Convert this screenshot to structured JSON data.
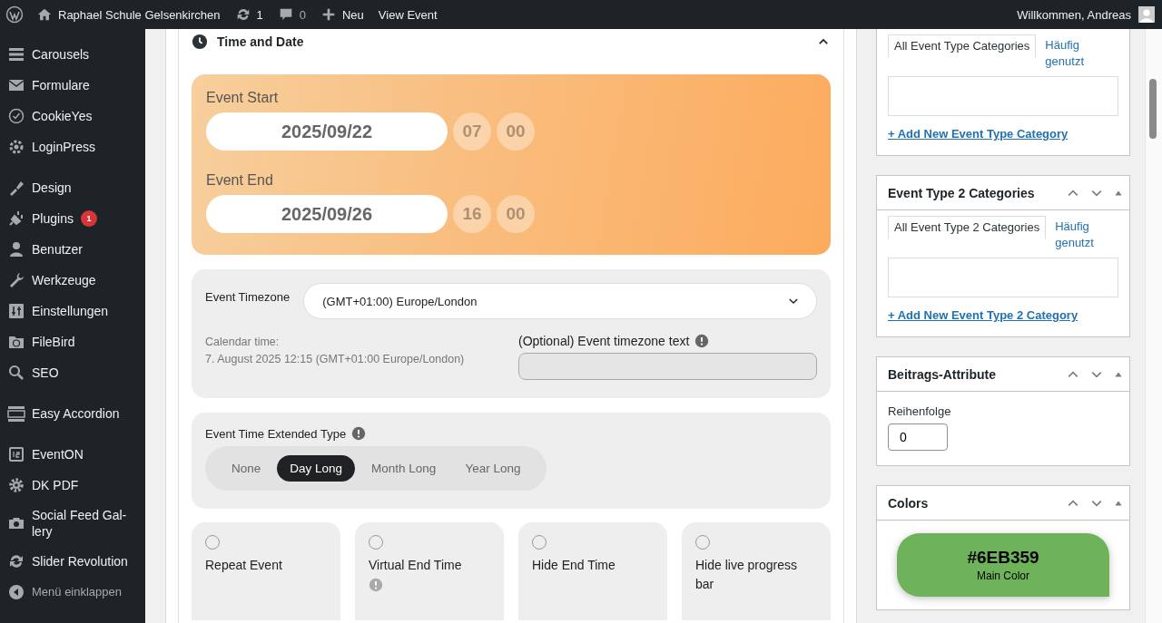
{
  "admin_bar": {
    "site": "Raphael Schule Gelsenkirchen",
    "updates": "1",
    "comments": "0",
    "new": "Neu",
    "view": "View Event",
    "greeting": "Willkommen, Andreas"
  },
  "sidebar": {
    "items": [
      {
        "kind": "menu",
        "label": "Carousels"
      },
      {
        "kind": "menu",
        "label": "Formulare"
      },
      {
        "kind": "menu",
        "label": "CookieYes"
      },
      {
        "kind": "menu",
        "label": "LoginPress"
      },
      {
        "kind": "separator"
      },
      {
        "kind": "menu",
        "label": "Design"
      },
      {
        "kind": "menu",
        "label": "Plugins",
        "badge": "1"
      },
      {
        "kind": "menu",
        "label": "Benutzer"
      },
      {
        "kind": "menu",
        "label": "Werkzeuge"
      },
      {
        "kind": "menu",
        "label": "Einstellungen"
      },
      {
        "kind": "menu",
        "label": "FileBird"
      },
      {
        "kind": "menu",
        "label": "SEO"
      },
      {
        "kind": "separator"
      },
      {
        "kind": "menu",
        "label": "Easy Accordion"
      },
      {
        "kind": "separator"
      },
      {
        "kind": "menu",
        "label": "EventON"
      },
      {
        "kind": "menu",
        "label": "DK PDF"
      },
      {
        "kind": "menu",
        "label": "Social Feed Gal-lery"
      },
      {
        "kind": "menu",
        "label": "Slider Revolution"
      }
    ],
    "collapse": "Menü einklappen"
  },
  "time_and_date": {
    "title": "Time and Date",
    "expanded": true,
    "ranges": [
      {
        "label": "Event Start",
        "date": "2025/09/22",
        "hour": "07",
        "minute": "00"
      },
      {
        "label": "Event End",
        "date": "2025/09/26",
        "hour": "16",
        "minute": "00"
      }
    ],
    "timezone": {
      "label": "Event Timezone",
      "value": "(GMT+01:00) Europe/London",
      "calendar_label": "Calendar time:",
      "calendar_value": "7. August 2025 12:15 (GMT+01:00 Europe/London)",
      "text_label": "(Optional) Event timezone text"
    },
    "extended_type": {
      "label": "Event Time Extended Type",
      "options": [
        {
          "label": "None",
          "selected": false
        },
        {
          "label": "Day Long",
          "selected": true
        },
        {
          "label": "Month Long",
          "selected": false
        },
        {
          "label": "Year Long",
          "selected": false
        }
      ]
    },
    "options": [
      {
        "label": "Repeat Event",
        "checked": false,
        "info": false
      },
      {
        "label": "Virtual End Time",
        "checked": false,
        "info": true
      },
      {
        "label": "Hide End Time",
        "checked": false,
        "info": false
      },
      {
        "label": "Hide live progress bar",
        "checked": false,
        "info": false
      }
    ]
  },
  "right_panels": {
    "event_type": {
      "tabs": [
        {
          "label": "All Event Type Categories",
          "selected": true
        },
        {
          "label": "Häufig genutzt",
          "selected": false
        }
      ],
      "add_link": "+ Add New Event Type Category"
    },
    "event_type_2": {
      "title": "Event Type 2 Categories",
      "tabs": [
        {
          "label": "All Event Type 2 Categories",
          "selected": true
        },
        {
          "label": "Häufig genutzt",
          "selected": false
        }
      ],
      "add_link": "+ Add New Event Type 2 Category"
    },
    "attributes": {
      "title": "Beitrags-Attribute",
      "order_label": "Reihenfolge",
      "order_value": "0"
    },
    "colors": {
      "title": "Colors",
      "items": [
        {
          "hex": "#6EB359",
          "label": "Main Color",
          "color": "#6eb359"
        }
      ]
    }
  }
}
